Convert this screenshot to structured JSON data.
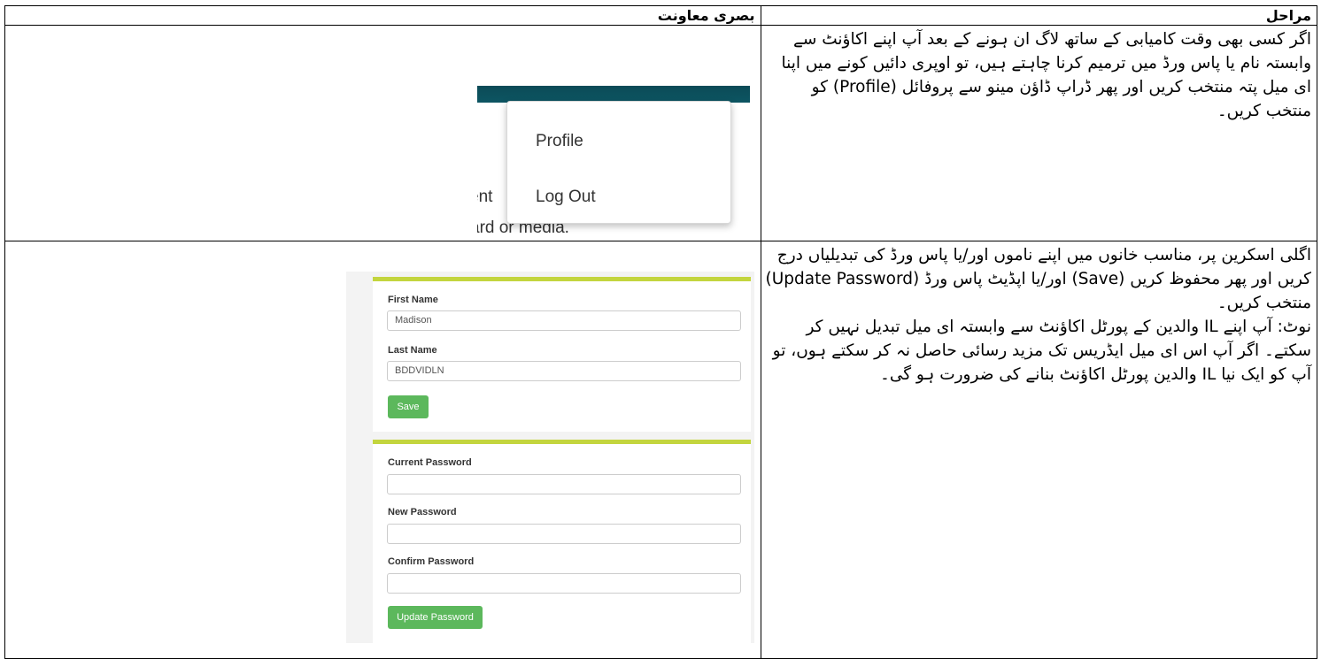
{
  "table": {
    "headers": {
      "steps": "مراحل",
      "visual_aid": "بصری معاونت"
    },
    "rows": [
      {
        "step_text": "اگر کسی بھی وقت کامیابی کے ساتھ لاگ ان ہونے کے بعد آپ اپنے اکاؤنٹ سے وابستہ نام یا پاس ورڈ میں ترمیم کرنا چاہتے ہیں، تو اوپری دائیں کونے میں اپنا ای میل پتہ منتخب کریں اور پھر ڈراپ ڈاؤن مینو سے پروفائل (Profile) کو منتخب کریں۔"
      },
      {
        "step_text": "اگلی اسکرین پر، مناسب خانوں میں اپنے ناموں اور/یا پاس ورڈ کی تبدیلیاں درج کریں اور پھر محفوظ کریں (Save) اور/یا اپڈیٹ پاس ورڈ (Update Password) منتخب کریں۔",
        "note_text": "نوٹ: آپ اپنے IL والدین کے پورٹل اکاؤنٹ سے وابستہ ای میل تبدیل نہیں کر سکتے۔ اگر آپ اس ای میل ایڈریس تک مزید رسائی حاصل نہ کر سکتے ہوں، تو آپ کو ایک نیا IL والدین پورٹل اکاؤنٹ بنانے کی ضرورت ہو گی۔"
      }
    ]
  },
  "screenshot_menu": {
    "items": [
      "Profile",
      "Log Out"
    ],
    "background_fragments": [
      "ent",
      "ard or media."
    ],
    "colors": {
      "topbar": "#0b4b57",
      "text": "#333333"
    }
  },
  "screenshot_form": {
    "profile": {
      "first_name_label": "First Name",
      "first_name_value": "Madison",
      "last_name_label": "Last Name",
      "last_name_value": "BDDVIDLN",
      "save_label": "Save"
    },
    "password": {
      "current_label": "Current Password",
      "new_label": "New Password",
      "confirm_label": "Confirm Password",
      "update_label": "Update Password"
    },
    "colors": {
      "panel_border": "#c3d53e",
      "button": "#5cb85c"
    }
  }
}
